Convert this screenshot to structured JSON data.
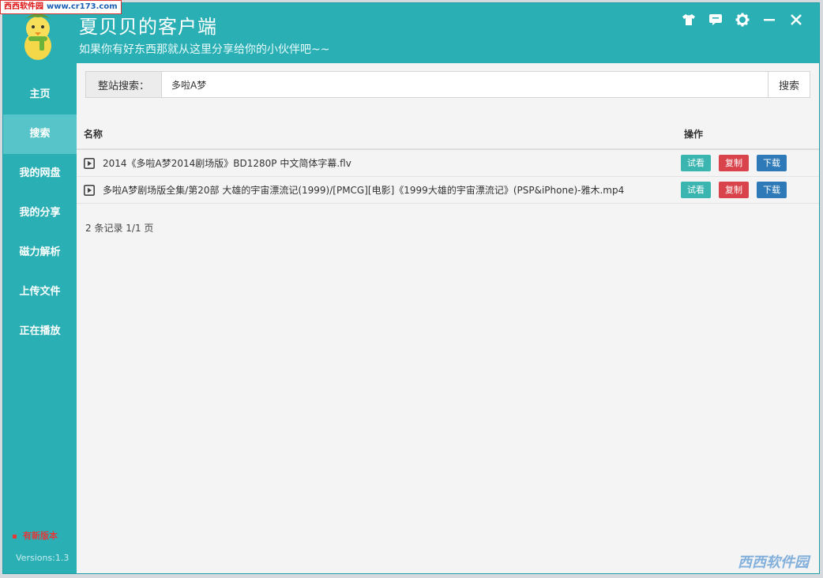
{
  "watermark": {
    "site_cn": "西西软件园",
    "url": "www.cr173.com",
    "bottom": "西西软件园"
  },
  "app": {
    "title": "夏贝贝的客户端",
    "subtitle": "如果你有好东西那就从这里分享给你的小伙伴吧~~"
  },
  "window_controls": [
    "tshirt-icon",
    "feedback-icon",
    "gear-icon",
    "minimize-icon",
    "close-icon"
  ],
  "sidebar": {
    "items": [
      {
        "label": "主页",
        "active": false
      },
      {
        "label": "搜索",
        "active": true
      },
      {
        "label": "我的网盘",
        "active": false
      },
      {
        "label": "我的分享",
        "active": false
      },
      {
        "label": "磁力解析",
        "active": false
      },
      {
        "label": "上传文件",
        "active": false
      },
      {
        "label": "正在播放",
        "active": false
      }
    ],
    "new_version": "有新版本",
    "version": "Versions:1.3"
  },
  "search": {
    "label": "整站搜索：",
    "value": "多啦A梦",
    "button": "搜索"
  },
  "table": {
    "col_name": "名称",
    "col_ops": "操作",
    "rows": [
      {
        "name": "2014《多啦A梦2014剧场版》BD1280P 中文简体字幕.flv"
      },
      {
        "name": "多啦A梦剧场版全集/第20部 大雄的宇宙漂流记(1999)/[PMCG][电影]《1999大雄的宇宙漂流记》(PSP&iPhone)-雅木.mp4"
      }
    ],
    "actions": {
      "preview": "试看",
      "copy": "复制",
      "download": "下载"
    }
  },
  "pagination": "2 条记录 1/1 页",
  "colors": {
    "accent": "#2aafb5",
    "preview": "#3bb5b0",
    "copy": "#d9434b",
    "download": "#2e7ab8"
  }
}
